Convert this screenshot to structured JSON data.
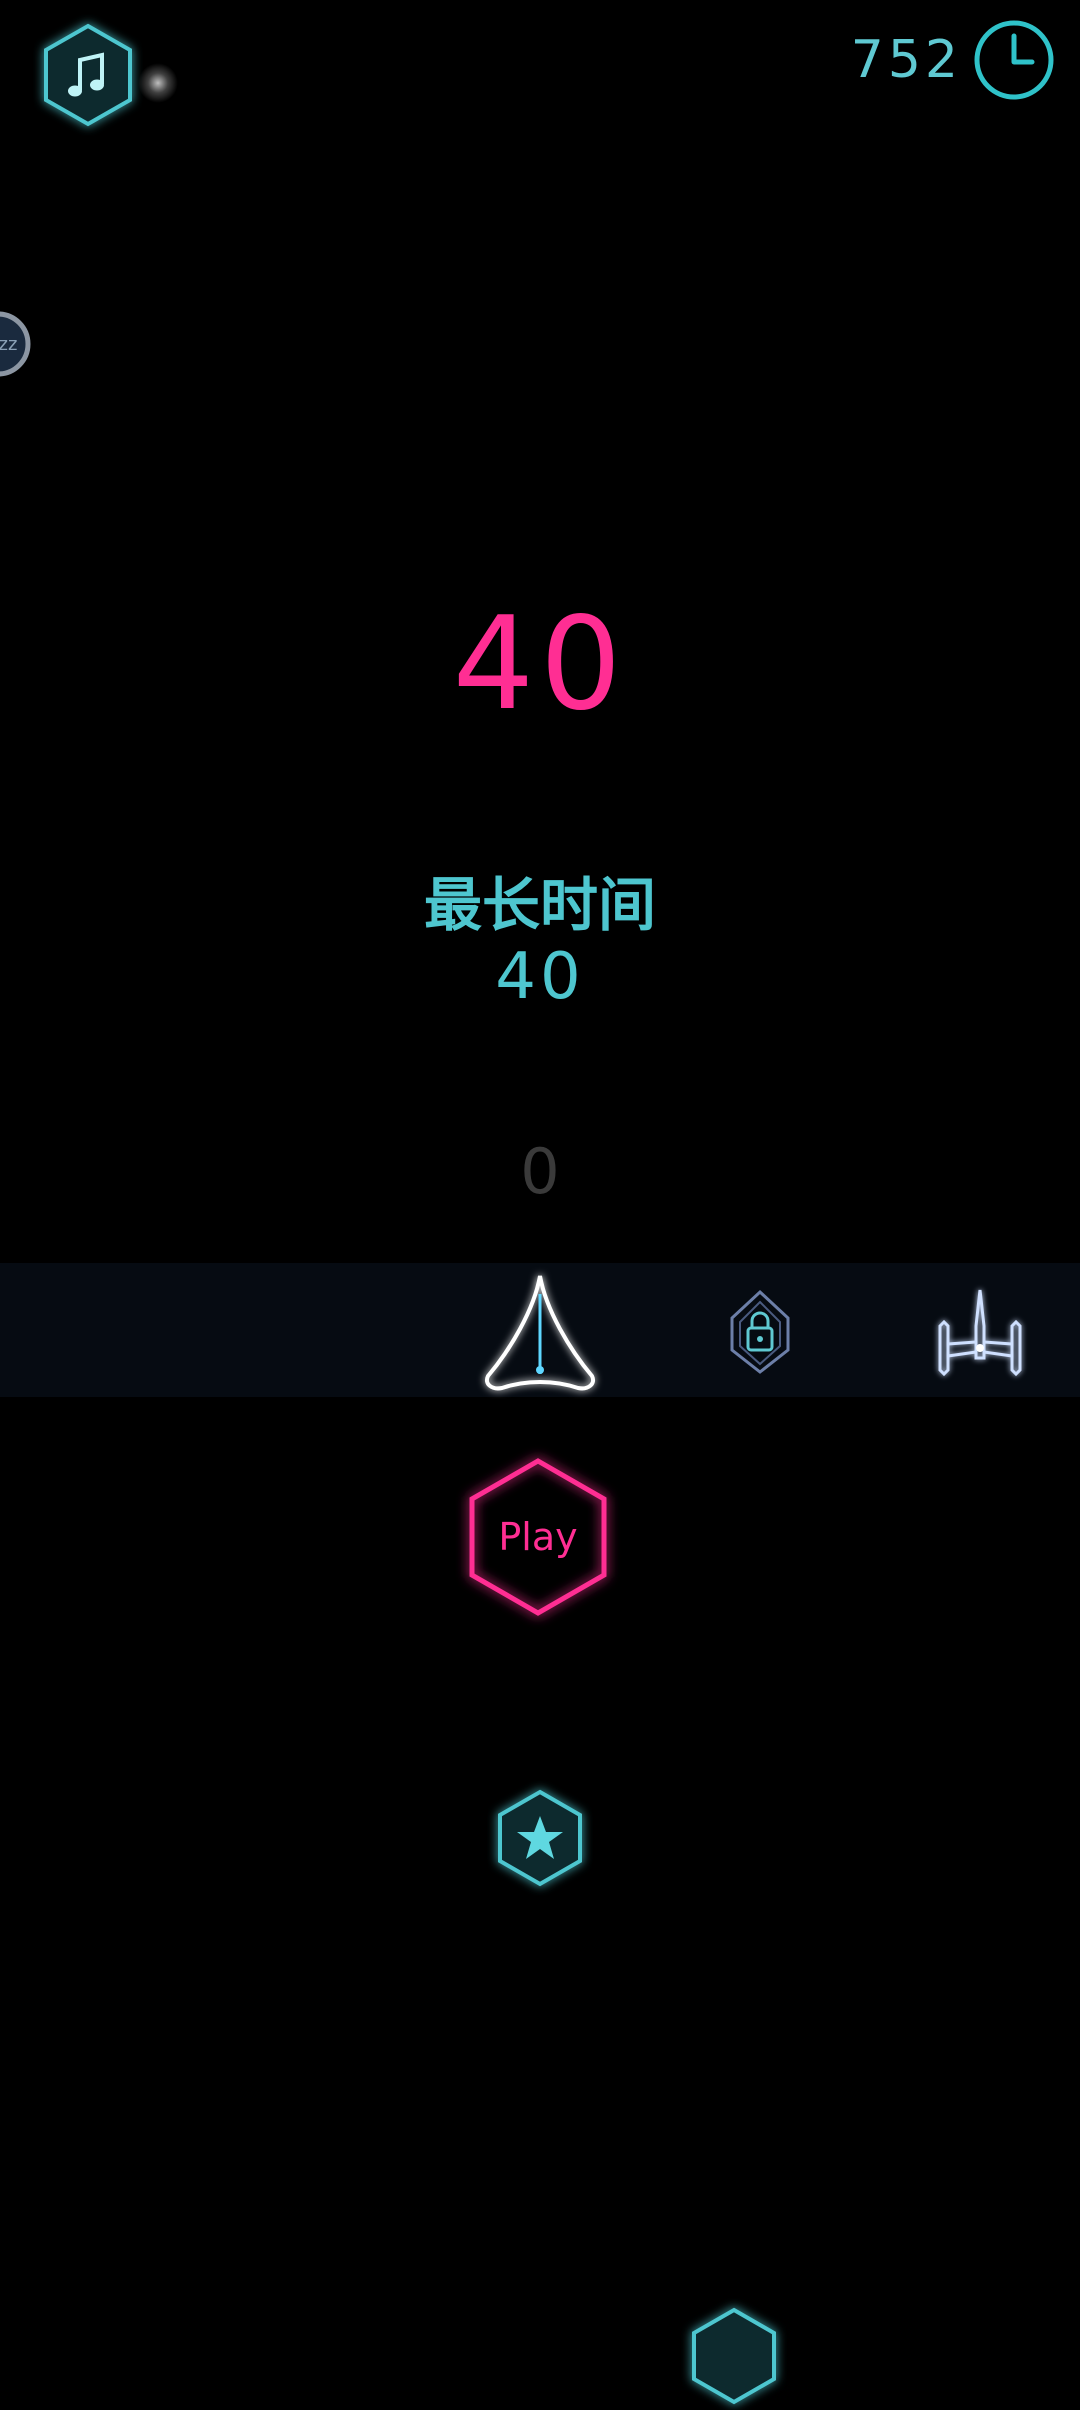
{
  "header": {
    "music_icon": "music-note-icon",
    "timer_value": "752",
    "timer_icon": "clock-icon"
  },
  "side": {
    "sleep_badge_text": "zz",
    "sleep_icon": "sleep-icon"
  },
  "score": {
    "current": "40",
    "best_label": "最长时间",
    "best_value": "40",
    "coins": "0"
  },
  "ships": [
    {
      "name": "arrow-ship",
      "locked": false,
      "selected": true
    },
    {
      "name": "shield-ship",
      "locked": true,
      "selected": false
    },
    {
      "name": "tie-fighter-ship",
      "locked": false,
      "selected": false
    }
  ],
  "actions": {
    "play_label": "Play",
    "rate_icon": "star-icon"
  },
  "colors": {
    "accent_pink": "#ff2e93",
    "accent_cyan": "#4ec6cf",
    "background": "#000000",
    "strip": "#060b12"
  }
}
